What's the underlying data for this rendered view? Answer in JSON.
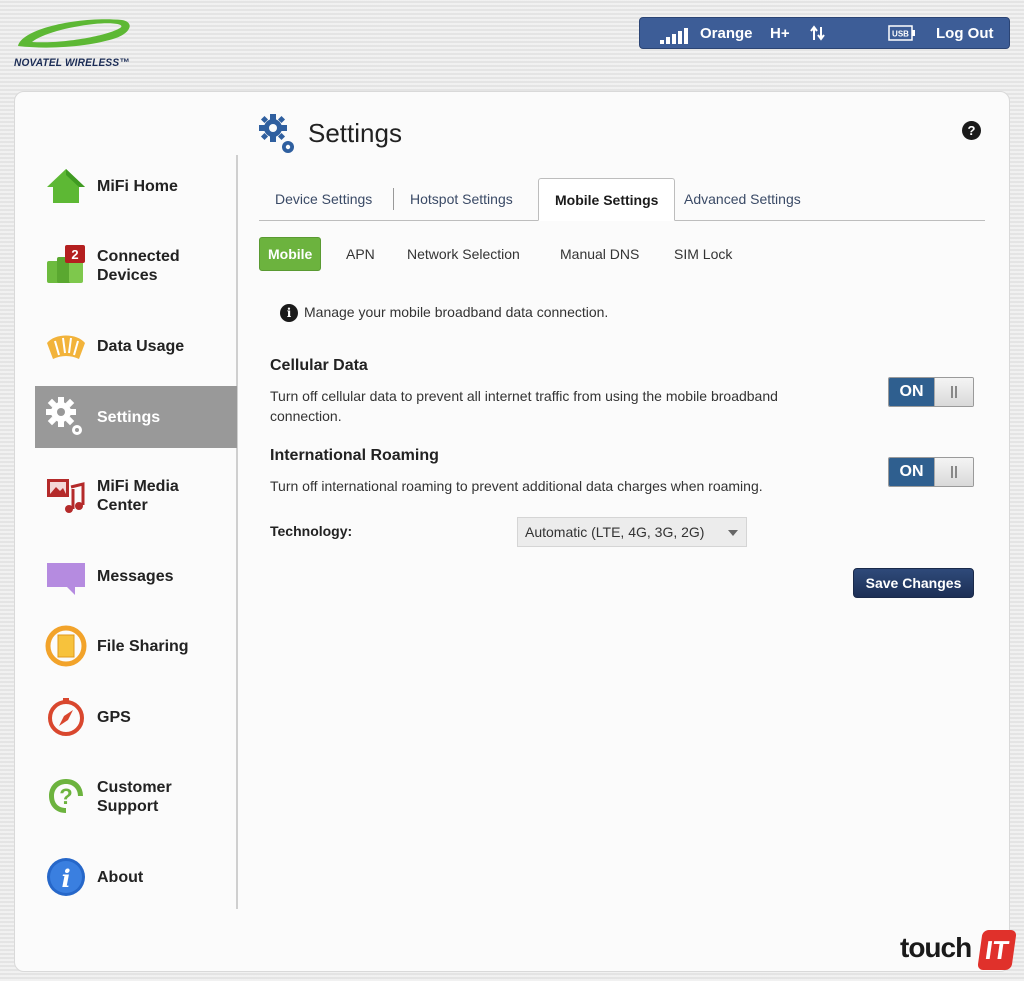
{
  "brand": {
    "logo_text": "NOVATEL WIRELESS™"
  },
  "status": {
    "carrier": "Orange",
    "network_type": "H+",
    "usb_label": "USB",
    "logout_label": "Log Out"
  },
  "sidebar": {
    "items": [
      {
        "label": "MiFi Home",
        "icon": "house-icon"
      },
      {
        "label": "Connected\nDevices",
        "icon": "devices-icon",
        "badge": "2"
      },
      {
        "label": "Data Usage",
        "icon": "gauge-icon"
      },
      {
        "label": "Settings",
        "icon": "gear-icon",
        "active": true
      },
      {
        "label": "MiFi Media\nCenter",
        "icon": "media-icon"
      },
      {
        "label": "Messages",
        "icon": "message-icon"
      },
      {
        "label": "File Sharing",
        "icon": "file-sharing-icon"
      },
      {
        "label": "GPS",
        "icon": "compass-icon"
      },
      {
        "label": "Customer\nSupport",
        "icon": "support-icon"
      },
      {
        "label": "About",
        "icon": "info-icon"
      }
    ]
  },
  "page": {
    "title": "Settings",
    "help": "?"
  },
  "tabs": [
    {
      "label": "Device Settings"
    },
    {
      "label": "Hotspot Settings"
    },
    {
      "label": "Mobile Settings",
      "active": true
    },
    {
      "label": "Advanced Settings"
    }
  ],
  "subtabs": [
    {
      "label": "Mobile",
      "active": true
    },
    {
      "label": "APN"
    },
    {
      "label": "Network Selection"
    },
    {
      "label": "Manual DNS"
    },
    {
      "label": "SIM Lock"
    }
  ],
  "info": {
    "icon": "i",
    "text": "Manage your mobile broadband data connection."
  },
  "cellular": {
    "title": "Cellular Data",
    "description": "Turn off cellular data to prevent all internet traffic from using the mobile broadband connection.",
    "toggle": "ON"
  },
  "roaming": {
    "title": "International Roaming",
    "description": "Turn off international roaming to prevent additional data charges when roaming.",
    "toggle": "ON"
  },
  "technology": {
    "label": "Technology:",
    "selected": "Automatic (LTE, 4G, 3G, 2G)"
  },
  "save_label": "Save Changes",
  "watermark": {
    "text": "touch",
    "box": "IT"
  },
  "colors": {
    "status_bar": "#3d5d97",
    "active_nav": "#999999",
    "subtab_active": "#6cb33e",
    "toggle_on": "#2f5f8f",
    "save_button": "#1c2f55",
    "logo_green": "#5db834",
    "watermark_red": "#e0312b"
  }
}
